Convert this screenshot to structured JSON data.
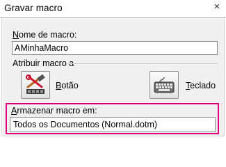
{
  "window": {
    "title": "Gravar macro",
    "close_glyph": "×"
  },
  "macro_name": {
    "label_prefix": "",
    "label_underlined": "N",
    "label_rest": "ome de macro:",
    "value": "AMinhaMacro"
  },
  "assign": {
    "label": "Atribuir macro a",
    "button": {
      "label_underlined": "B",
      "label_rest": "otão",
      "icon": "hammer-wrench-icon"
    },
    "keyboard": {
      "label_underlined": "T",
      "label_rest": "eclado",
      "icon": "keyboard-icon"
    }
  },
  "store": {
    "label_underlined": "A",
    "label_rest": "rmazenar macro em:",
    "value": "Todos os Documentos (Normal.dotm)"
  },
  "colors": {
    "highlight": "#e0007d",
    "dialog_bg": "#f0f0f0"
  }
}
